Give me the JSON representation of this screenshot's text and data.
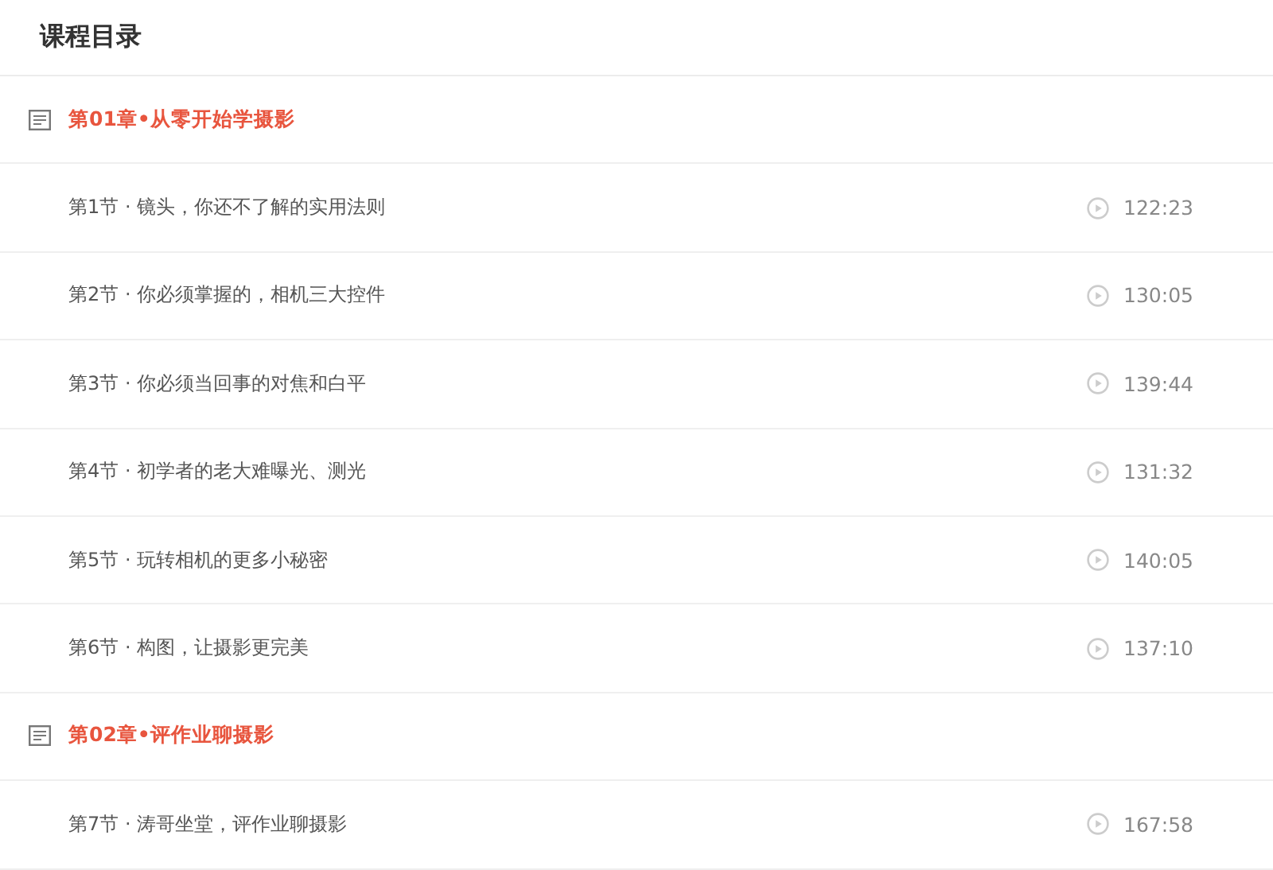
{
  "title": "课程目录",
  "chapters": [
    {
      "title": "第01章•从零开始学摄影",
      "lessons": [
        {
          "title": "第1节 · 镜头，你还不了解的实用法则",
          "duration": "122:23"
        },
        {
          "title": "第2节 · 你必须掌握的，相机三大控件",
          "duration": "130:05"
        },
        {
          "title": "第3节 · 你必须当回事的对焦和白平",
          "duration": "139:44"
        },
        {
          "title": "第4节 · 初学者的老大难曝光、测光",
          "duration": "131:32"
        },
        {
          "title": "第5节 · 玩转相机的更多小秘密",
          "duration": "140:05"
        },
        {
          "title": "第6节 · 构图，让摄影更完美",
          "duration": "137:10"
        }
      ]
    },
    {
      "title": "第02章•评作业聊摄影",
      "lessons": [
        {
          "title": "第7节 · 涛哥坐堂，评作业聊摄影",
          "duration": "167:58"
        }
      ]
    }
  ]
}
